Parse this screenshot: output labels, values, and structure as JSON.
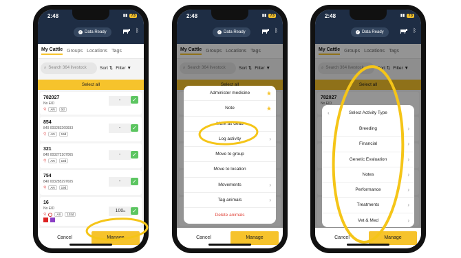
{
  "status": {
    "time": "2:48",
    "battery": "73",
    "ready": "Data Ready"
  },
  "tabs": [
    "My Cattle",
    "Groups",
    "Locations",
    "Tags"
  ],
  "toolbar": {
    "search_placeholder": "Search 364 livestock",
    "sort": "Sort",
    "filter": "Filter"
  },
  "select_all": "Select all",
  "cards": [
    {
      "id": "782027",
      "sub": "No EID",
      "sex": "AN",
      "age": "0d",
      "value": "-"
    },
    {
      "id": "854",
      "sub": "840 003283269933",
      "sex": "AN",
      "age": "19d",
      "value": "-"
    },
    {
      "id": "321",
      "sub": "840 003272107065",
      "sex": "AN",
      "age": "19d",
      "value": "-"
    },
    {
      "id": "754",
      "sub": "840 003285297605",
      "sex": "AN",
      "age": "19d",
      "value": "-"
    },
    {
      "id": "16",
      "sub": "No EID",
      "sex": "AS",
      "age": "103d",
      "value": "100",
      "value_unit": "lb"
    }
  ],
  "buttons": {
    "cancel": "Cancel",
    "manage": "Manage"
  },
  "action_menu": [
    "Administer medicine",
    "Note",
    "Mark as dead",
    "Log activity",
    "Move to group",
    "Move to location",
    "Movements",
    "Tag animals",
    "Delete animals"
  ],
  "activity_menu": {
    "title": "Select Activity Type",
    "items": [
      "Breeding",
      "Financial",
      "Genetic Evaluation",
      "Notes",
      "Performance",
      "Treatments",
      "Vet & Med"
    ]
  },
  "colors": {
    "accent": "#f6c32c",
    "header": "#1e2d44",
    "check": "#5cc561",
    "danger": "#e0453a",
    "annotation": "#f5c518"
  }
}
